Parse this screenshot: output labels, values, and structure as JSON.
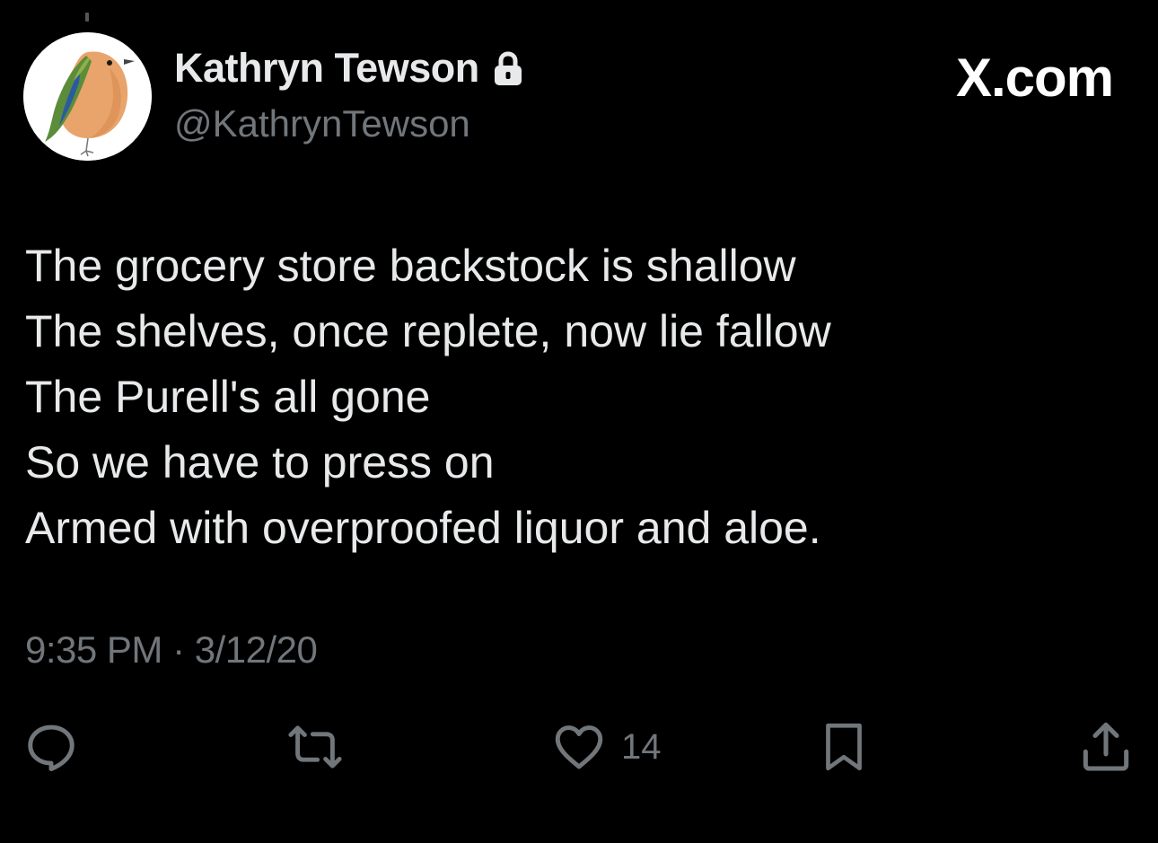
{
  "author": {
    "display_name": "Kathryn Tewson",
    "handle": "@KathrynTewson",
    "avatar_icon": "bird-illustration-avatar",
    "protected_icon": "lock-icon"
  },
  "brand": {
    "label": "X.com"
  },
  "tweet": {
    "lines": [
      "The grocery store backstock is shallow",
      "The shelves, once replete, now lie fallow",
      "The Purell's all gone",
      "So we have to press on",
      "Armed with overproofed liquor and aloe."
    ],
    "timestamp": "9:35 PM · 3/12/20"
  },
  "actions": {
    "reply_icon": "reply-icon",
    "retweet_icon": "retweet-icon",
    "like_icon": "heart-icon",
    "like_count": "14",
    "bookmark_icon": "bookmark-icon",
    "share_icon": "share-icon"
  },
  "colors": {
    "background": "#000000",
    "primary_text": "#e7e9ea",
    "secondary_text": "#71767b"
  }
}
